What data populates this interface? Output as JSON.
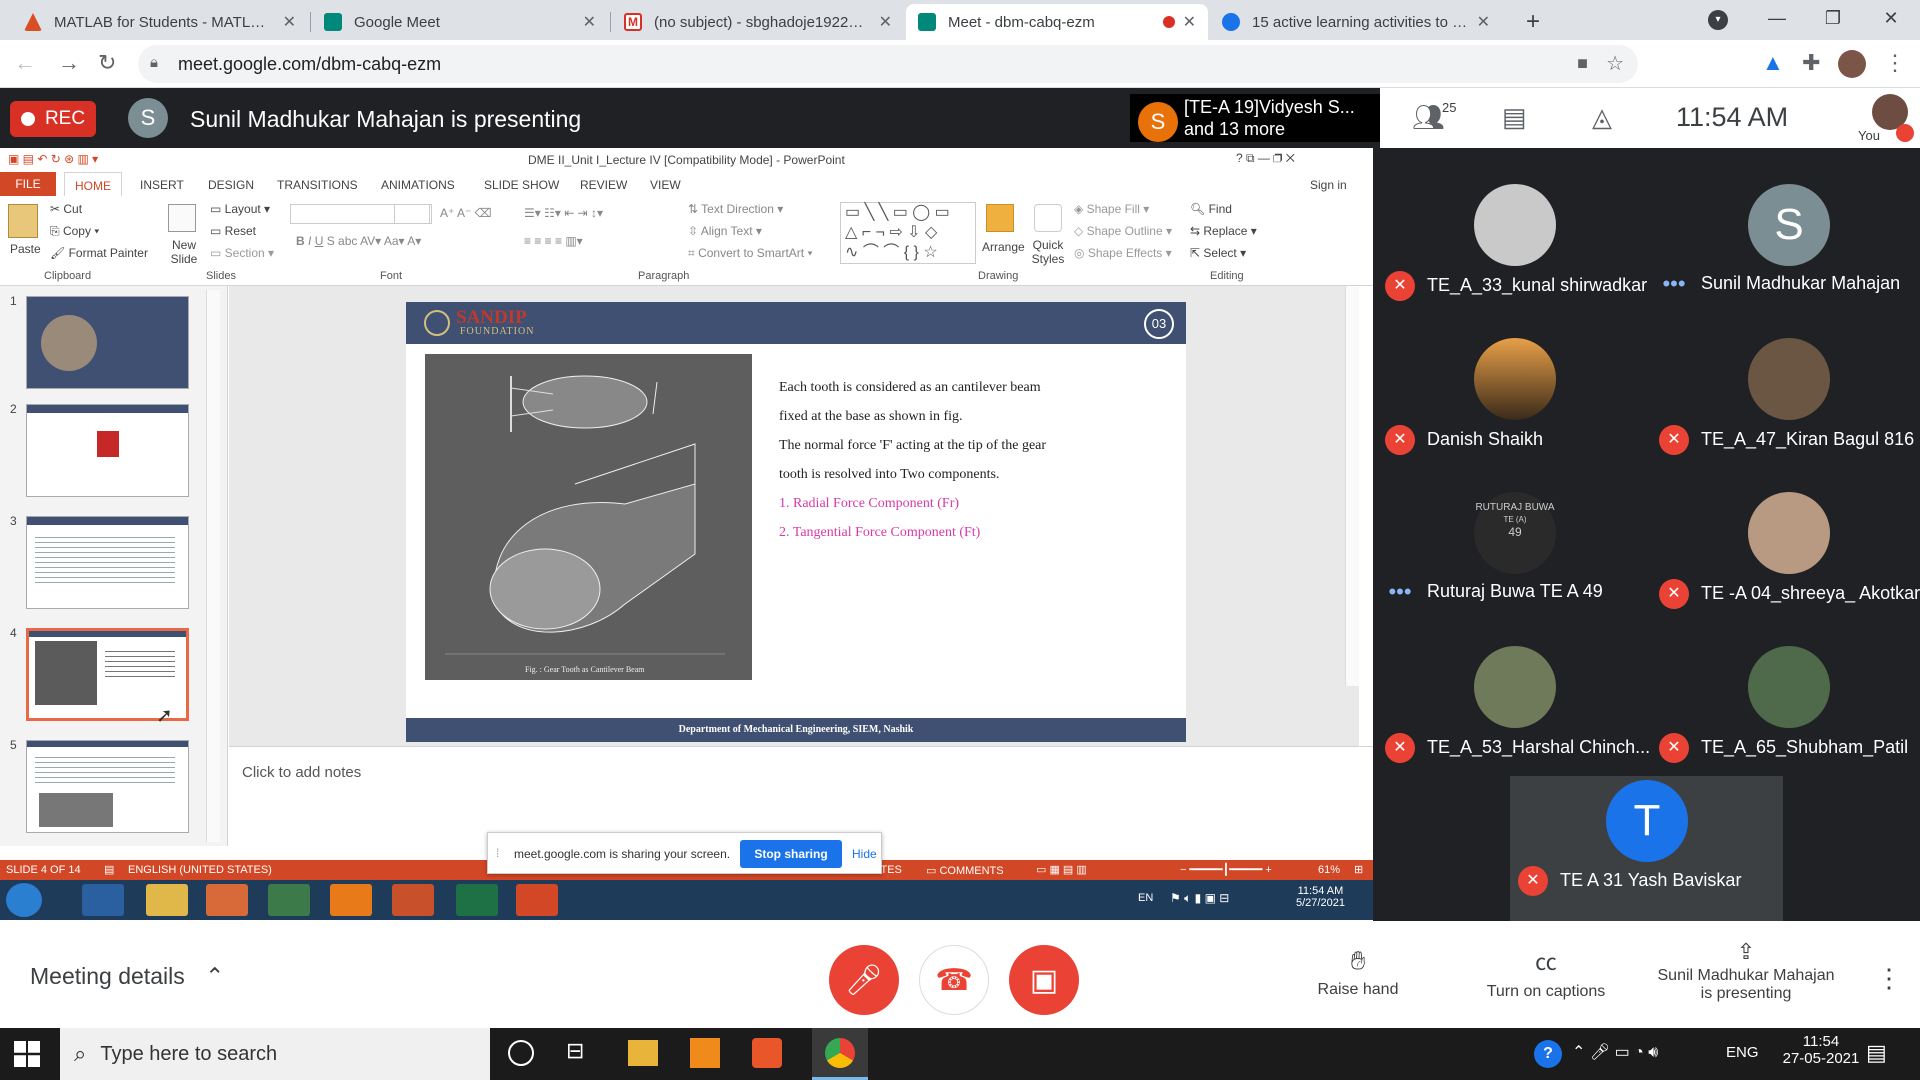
{
  "browser": {
    "tabs": [
      {
        "title": "MATLAB for Students - MATLAB &",
        "favcolor": "#d94f24"
      },
      {
        "title": "Google Meet",
        "favcolor": "#00897b"
      },
      {
        "title": "(no subject) - sbghadoje1922192",
        "favcolor": "#d93025"
      },
      {
        "title": "Meet - dbm-cabq-ezm",
        "favcolor": "#00897b"
      },
      {
        "title": "15 active learning activities to en",
        "favcolor": "#1a73e8"
      }
    ],
    "url": "meet.google.com/dbm-cabq-ezm"
  },
  "meet": {
    "rec_label": "REC",
    "presenter_initial": "S",
    "presenting_text": "Sunil Madhukar Mahajan is presenting",
    "featured_initial": "S",
    "featured_name_line1": "[TE-A 19]Vidyesh S...",
    "featured_name_line2": "and 13 more",
    "participant_count": "25",
    "clock": "11:54 AM",
    "you_label": "You"
  },
  "ppt": {
    "title": "DME II_Unit I_Lecture IV [Compatibility Mode] - PowerPoint",
    "ribbon_tabs": [
      "FILE",
      "HOME",
      "INSERT",
      "DESIGN",
      "TRANSITIONS",
      "ANIMATIONS",
      "SLIDE SHOW",
      "REVIEW",
      "VIEW"
    ],
    "signin": "Sign in",
    "clipboard": {
      "paste": "Paste",
      "cut": "Cut",
      "copy": "Copy",
      "format_painter": "Format Painter",
      "group": "Clipboard"
    },
    "slides": {
      "new_slide": "New Slide",
      "layout": "Layout",
      "reset": "Reset",
      "section": "Section",
      "group": "Slides"
    },
    "font": {
      "group": "Font"
    },
    "paragraph": {
      "text_direction": "Text Direction",
      "align_text": "Align Text",
      "convert": "Convert to SmartArt",
      "group": "Paragraph"
    },
    "drawing": {
      "arrange": "Arrange",
      "quick_styles": "Quick Styles",
      "shape_fill": "Shape Fill",
      "shape_outline": "Shape Outline",
      "shape_effects": "Shape Effects",
      "group": "Drawing"
    },
    "editing": {
      "find": "Find",
      "replace": "Replace",
      "select": "Select",
      "group": "Editing"
    },
    "thumb_numbers": [
      "1",
      "2",
      "3",
      "4",
      "5"
    ],
    "slide": {
      "logo": "SANDIP",
      "logo_sub": "FOUNDATION",
      "page_no": "03",
      "lines": [
        "Each tooth is considered as an cantilever beam",
        "fixed at the base as shown in fig.",
        "The normal force 'F' acting at the tip of the gear",
        "tooth is resolved into Two components."
      ],
      "pink_lines": [
        "1. Radial Force Component (Fr)",
        "2. Tangential Force Component (Ft)"
      ],
      "fig_caption": "Fig. : Gear Tooth as Cantilever Beam",
      "footer": "Department of Mechanical Engineering, SIEM, Nashik"
    },
    "notes_placeholder": "Click to add notes",
    "status_slide": "SLIDE 4 OF 14",
    "status_lang": "ENGLISH (UNITED STATES)",
    "status_notes": "NOTES",
    "status_comments": "COMMENTS",
    "zoom": "61%",
    "share_notice": "meet.google.com is sharing your screen.",
    "stop_sharing": "Stop sharing",
    "hide": "Hide",
    "win_lang": "EN",
    "win_time": "11:54 AM",
    "win_date": "5/27/2021"
  },
  "participants": [
    {
      "name": "TE_A_33_kunal shirwadkar",
      "muted": true,
      "pic": "#c9c9c9",
      "initial": ""
    },
    {
      "name": "Sunil Madhukar Mahajan",
      "muted": false,
      "pic": "#7b8e93",
      "initial": "S"
    },
    {
      "name": "Danish Shaikh",
      "muted": true,
      "pic": "#b5692b",
      "initial": ""
    },
    {
      "name": "TE_A_47_Kiran Bagul 816",
      "muted": true,
      "pic": "#6b5644",
      "initial": ""
    },
    {
      "name": "Ruturaj Buwa TE A 49",
      "muted": false,
      "pic": "#2a2a2a",
      "initial": "RUTURAJ BUWA"
    },
    {
      "name": "TE -A 04_shreeya_ Akotkar",
      "muted": true,
      "pic": "#b89a83",
      "initial": ""
    },
    {
      "name": "TE_A_53_Harshal Chinch...",
      "muted": true,
      "pic": "#6f7a5b",
      "initial": ""
    },
    {
      "name": "TE_A_65_Shubham_Patil",
      "muted": true,
      "pic": "#4f6a4a",
      "initial": ""
    },
    {
      "name": "TE A 31 Yash Baviskar",
      "muted": true,
      "pic": "#1a73e8",
      "initial": "T"
    }
  ],
  "ruturaj_sub": "TE   (A)",
  "ruturaj_num": "49",
  "bottom": {
    "meeting_details": "Meeting details",
    "raise_hand": "Raise hand",
    "captions": "Turn on captions",
    "presenting_line1": "Sunil Madhukar Mahajan",
    "presenting_line2": "is presenting"
  },
  "taskbar": {
    "search_placeholder": "Type here to search",
    "lang": "ENG",
    "time": "11:54",
    "date": "27-05-2021"
  },
  "colors": {
    "meet_red": "#ea4335",
    "rec_red": "#d93025",
    "ppt_orange": "#d24726",
    "slide_blue": "#3f5072"
  }
}
